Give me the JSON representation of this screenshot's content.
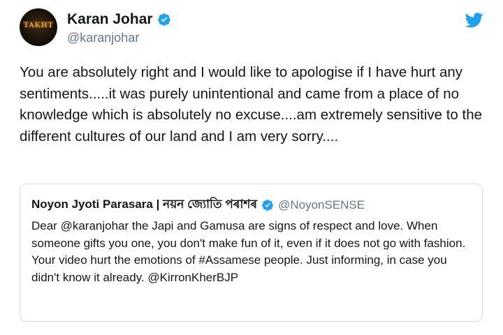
{
  "colors": {
    "accent": "#1da1f2",
    "text": "#14171a",
    "secondary_text": "#657786",
    "border": "#d6dde3"
  },
  "author": {
    "avatar_text": "TAKHT",
    "display_name": "Karan Johar",
    "handle": "@karanjohar",
    "verified_icon": "verified-badge-icon"
  },
  "brand_icon": "twitter-bird-icon",
  "tweet": {
    "text": "You are absolutely right and I would like to apologise if I have hurt any sentiments.....it was purely unintentional and came from a place of no knowledge which is absolutely no excuse....am extremely sensitive to the different cultures of our land and I am very sorry...."
  },
  "quoted_tweet": {
    "display_name": "Noyon Jyoti Parasara | নয়ন জ্যোতি পৰাশৰ",
    "handle": "@NoyonSENSE",
    "text": "Dear @karanjohar the Japi and Gamusa are signs of respect and love. When someone gifts you one, you don't make fun of it, even if it does not go with fashion. Your video hurt the emotions of #Assamese people. Just informing, in case you didn't know it already. @KirronKherBJP"
  }
}
